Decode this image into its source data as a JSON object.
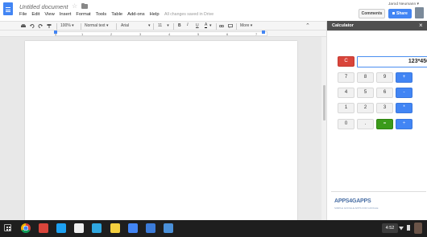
{
  "document": {
    "title": "Untitled document",
    "save_status": "All changes saved in Drive"
  },
  "menu": [
    "File",
    "Edit",
    "View",
    "Insert",
    "Format",
    "Tools",
    "Table",
    "Add-ons",
    "Help"
  ],
  "header": {
    "user_name": "Jarod Neumann",
    "comments_label": "Comments",
    "share_label": "Share"
  },
  "toolbar": {
    "zoom": "100%",
    "style": "Normal text",
    "font": "Arial",
    "size": "11",
    "more_label": "More"
  },
  "ruler": {
    "numbers": [
      "1",
      "1",
      "2",
      "3",
      "4",
      "5",
      "6",
      "7"
    ]
  },
  "calculator": {
    "title": "Calculator",
    "display": "123*456",
    "clear_label": "C",
    "rows": [
      [
        "7",
        "8",
        "9",
        "+"
      ],
      [
        "4",
        "5",
        "6",
        "-"
      ],
      [
        "1",
        "2",
        "3",
        "*"
      ],
      [
        "0",
        ".",
        "=",
        "÷"
      ]
    ]
  },
  "brand": {
    "name": "APPS4GAPPS",
    "tagline": "SIMPLE GOOGLE APPS FOR GOOGLE"
  },
  "taskbar": {
    "time": "4:52"
  },
  "colors": {
    "accent": "#4285f4",
    "clear": "#d9453b",
    "equals": "#3b9b1a",
    "sidebar_header": "#4f4f4f"
  }
}
